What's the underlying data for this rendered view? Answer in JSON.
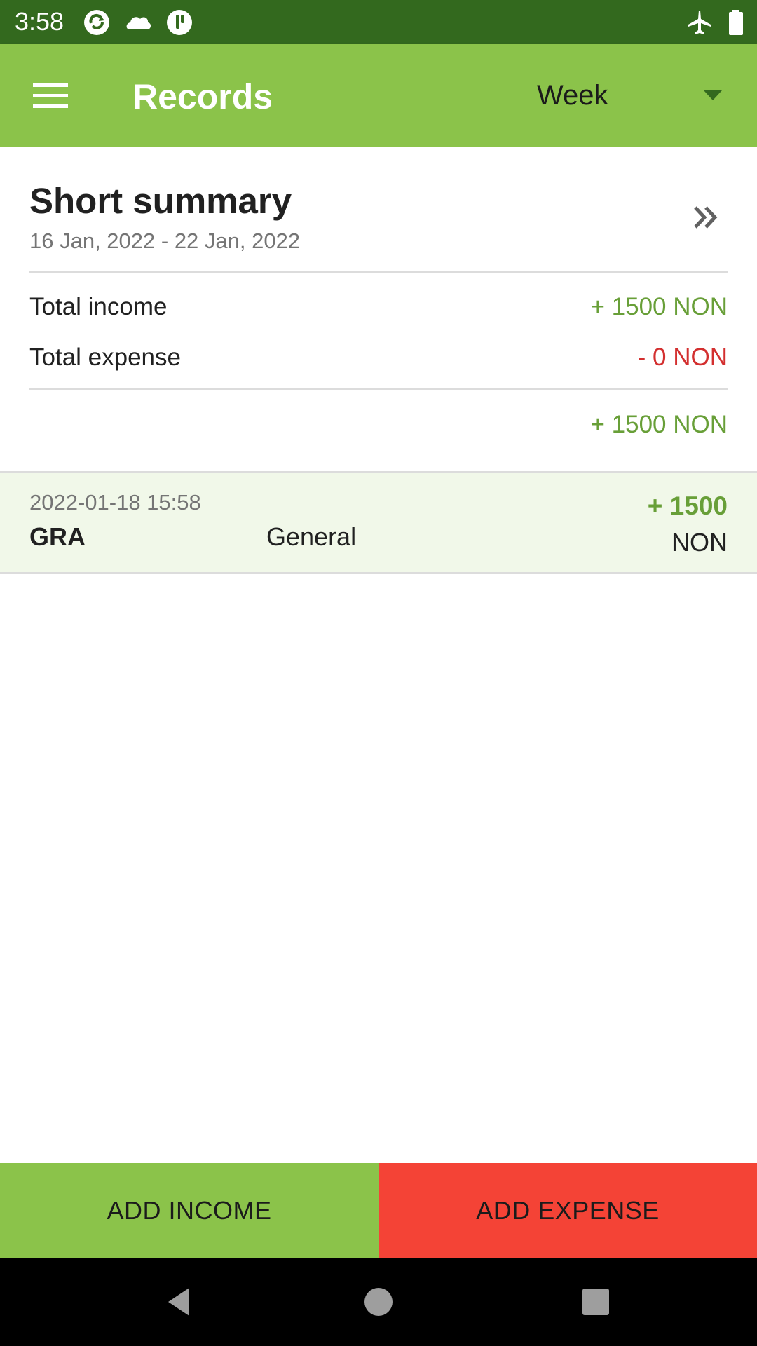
{
  "status_bar": {
    "time": "3:58",
    "left_icons": [
      "sync-icon",
      "cloud-icon",
      "app-notification-icon"
    ],
    "right_icons": [
      "airplane-mode-icon",
      "battery-icon"
    ]
  },
  "app_bar": {
    "menu_icon": "hamburger-menu-icon",
    "title": "Records",
    "period": {
      "selected": "Week",
      "icon": "dropdown-arrow-icon"
    }
  },
  "summary": {
    "title": "Short summary",
    "date_range": "16 Jan, 2022 - 22 Jan, 2022",
    "details_icon": "double-chevron-right-icon",
    "total_income_label": "Total income",
    "total_income_value": "+ 1500 NON",
    "total_expense_label": "Total expense",
    "total_expense_value": "- 0 NON",
    "balance_value": "+ 1500 NON"
  },
  "records": [
    {
      "datetime": "2022-01-18 15:58",
      "account": "GRA",
      "category": "General",
      "amount": "+ 1500",
      "currency": "NON"
    }
  ],
  "actions": {
    "add_income": "ADD INCOME",
    "add_expense": "ADD EXPENSE"
  },
  "navigation": {
    "back_icon": "back-triangle-icon",
    "home_icon": "home-circle-icon",
    "recents_icon": "recents-square-icon"
  },
  "colors": {
    "status_bar": "#33691e",
    "app_bar": "#8bc34a",
    "income": "#689f38",
    "expense": "#d32f2f",
    "add_expense_button": "#f44336",
    "record_background": "#f1f8e9"
  }
}
